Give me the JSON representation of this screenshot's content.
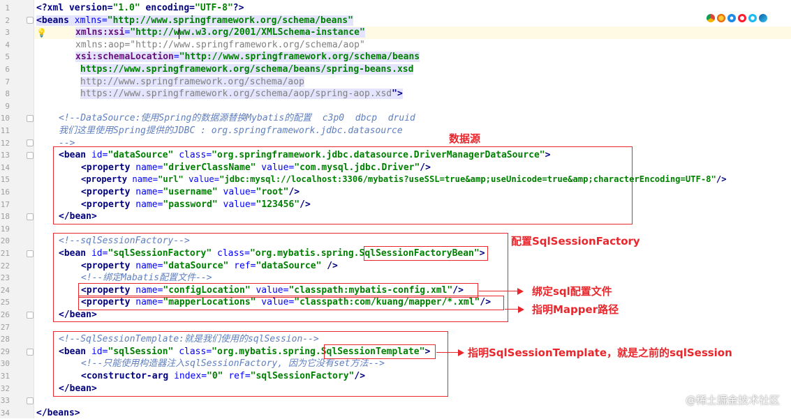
{
  "editor": {
    "line_numbers": [
      "1",
      "2",
      "3",
      "4",
      "5",
      "6",
      "7",
      "8",
      "9",
      "10",
      "11",
      "12",
      "13",
      "14",
      "15",
      "16",
      "17",
      "18",
      "19",
      "20",
      "21",
      "22",
      "23",
      "24",
      "25",
      "26",
      "27",
      "28",
      "29",
      "30",
      "31",
      "32",
      "33",
      "34"
    ],
    "code": {
      "l1": {
        "a": "<?xml version=",
        "b": "\"1.0\"",
        "c": " encoding=",
        "d": "\"UTF-8\"",
        "e": "?>"
      },
      "l2": {
        "a": "<beans ",
        "b": "xmlns=",
        "c": "\"http://www.springframework.org/schema/beans\""
      },
      "l3": {
        "ns": "xmlns:xsi",
        "eq": "=",
        "val": "\"http://www.w3.org/2001/XMLSchema-instance\""
      },
      "l4": "xmlns:aop=\"http://www.springframework.org/schema/aop\"",
      "l5": {
        "ns": "xsi:schemaLocation",
        "eq": "=",
        "val": "\"http://www.springframework.org/schema/beans"
      },
      "l6": "https://www.springframework.org/schema/beans/spring-beans.xsd",
      "l7": "http://www.springframework.org/schema/aop",
      "l8": "https://www.springframework.org/schema/aop/spring-aop.xsd",
      "l8end": "\">",
      "l10": "<!--DataSource:使用Spring的数据源替换Mybatis的配置  c3p0  dbcp  druid",
      "l11": "我们这里使用Spring提供的JDBC : org.springframework.jdbc.datasource",
      "l12": "-->",
      "l13": {
        "a": "<bean ",
        "b": "id=",
        "c": "\"dataSource\"",
        "d": " class=",
        "e": "\"org.springframework.jdbc.datasource.DriverManagerDataSource\"",
        "f": ">"
      },
      "l14": {
        "a": "<property ",
        "b": "name=",
        "c": "\"driverClassName\"",
        "d": " value=",
        "e": "\"com.mysql.jdbc.Driver\"",
        "f": "/>"
      },
      "l15": {
        "a": "<property ",
        "b": "name=",
        "c": "\"url\"",
        "d": " value=",
        "e": "\"jdbc:mysql://localhost:3306/mybatis?useSSL=true&amp;useUnicode=true&amp;characterEncoding=UTF-8\"",
        "f": "/>"
      },
      "l16": {
        "a": "<property ",
        "b": "name=",
        "c": "\"username\"",
        "d": " value=",
        "e": "\"root\"",
        "f": "/>"
      },
      "l17": {
        "a": "<property ",
        "b": "name=",
        "c": "\"password\"",
        "d": " value=",
        "e": "\"123456\"",
        "f": "/>"
      },
      "l18": "</bean>",
      "l20": "<!--sqlSessionFactory-->",
      "l21": {
        "a": "<bean ",
        "b": "id=",
        "c": "\"sqlSessionFactory\"",
        "d": " class=",
        "e": "\"org.mybatis.spring.",
        "e2": "SqlSessionFactoryBean",
        "e3": "\"",
        "f": ">"
      },
      "l22": {
        "a": "<property ",
        "b": "name=",
        "c": "\"dataSource\"",
        "d": " ref=",
        "e": "\"dataSource\"",
        "f": " />"
      },
      "l23": "<!--绑定Mabatis配置文件-->",
      "l24": {
        "a": "<property ",
        "b": "name=",
        "c": "\"configLocation\"",
        "d": " value=",
        "e": "\"classpath:mybatis-config.xml\"",
        "f": "/>"
      },
      "l25": {
        "a": "<property ",
        "b": "name=",
        "c": "\"mapperLocations\"",
        "d": " value=",
        "e": "\"classpath:com/kuang/mapper/*.xml\"",
        "f": "/>"
      },
      "l26": "</bean>",
      "l28": "<!--SqlSessionTemplate:就是我们使用的sqlSession-->",
      "l29": {
        "a": "<bean ",
        "b": "id=",
        "c": "\"sqlSession\"",
        "d": " class=",
        "e": "\"org.mybatis.spring.",
        "e2": "SqlSessionTemplate",
        "e3": "\"",
        "f": ">"
      },
      "l30": "<!--只能使用构造器注入sqlSessionFactory, 因为它没有set方法-->",
      "l31": {
        "a": "<constructor-arg ",
        "b": "index=",
        "c": "\"0\"",
        "d": " ref=",
        "e": "\"sqlSessionFactory\"",
        "f": "/>"
      },
      "l32": "</bean>",
      "l34": "</beans>"
    }
  },
  "annotations": {
    "datasource": "数据源",
    "factory": "配置SqlSessionFactory",
    "bind": "绑定sql配置文件",
    "mapper": "指明Mapper路径",
    "template": "指明SqlSessionTemplate，就是之前的sqlSession"
  },
  "watermark": "@稀土掘金技术社区",
  "colors": {
    "annotation": "#e8262c",
    "tag": "#000080",
    "attr": "#0000ff",
    "value": "#008000",
    "comment": "#5f7fbf"
  },
  "browser_icons": [
    "chrome-icon",
    "firefox-icon",
    "safari-icon",
    "opera-icon",
    "ie-icon",
    "edge-icon"
  ]
}
